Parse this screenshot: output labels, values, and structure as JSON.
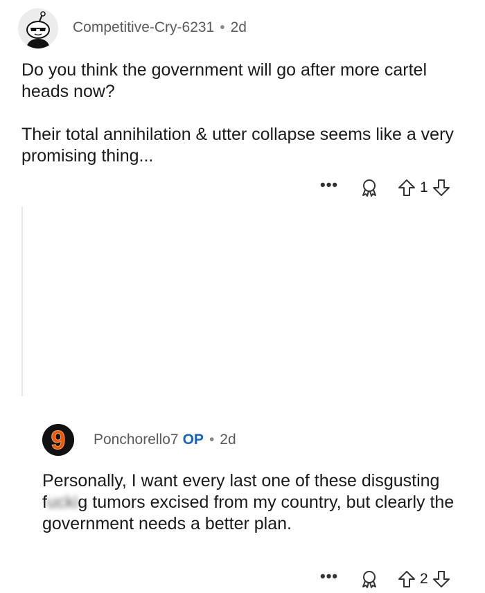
{
  "comments": [
    {
      "author": "Competitive-Cry-6231",
      "separator": "•",
      "age": "2d",
      "paragraphs": [
        "Do you think the government will go after more cartel heads now?",
        "Their total annihilation & utter collapse seems like a very promising thing..."
      ],
      "actions": {
        "more": "•••",
        "award_icon": "award-icon",
        "upvote_icon": "upvote-arrow-icon",
        "score": "1",
        "downvote_icon": "downvote-arrow-icon"
      }
    },
    {
      "author": "Ponchorello7",
      "op_badge": "OP",
      "separator": "•",
      "age": "2d",
      "avatar_char": "9",
      "body_pre": "Personally, I want every last one of these disgusting f",
      "body_blur": "ucki",
      "body_post": "g tumors excised from my country, but clearly the government needs a better plan.",
      "actions": {
        "more": "•••",
        "award_icon": "award-icon",
        "upvote_icon": "upvote-arrow-icon",
        "score": "2",
        "downvote_icon": "downvote-arrow-icon"
      }
    }
  ],
  "colors": {
    "op_badge": "#1565c0",
    "meta_text": "#5a5a5a",
    "avatar2_ring": "#e8590c"
  }
}
